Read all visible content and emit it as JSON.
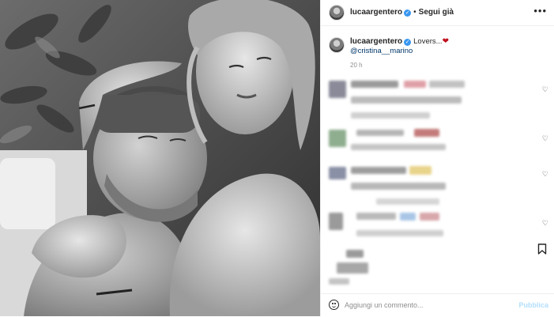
{
  "post": {
    "username": "lucaargentero",
    "follow_label": "Segui già",
    "more_icon": "•••",
    "caption": {
      "username": "lucaargentero",
      "message": "Lovers...",
      "heart": "❤",
      "mention": "@cristina__marino"
    },
    "time": "20 h",
    "photo_description": "Black and white photo of a couple embracing"
  },
  "comments": [
    {
      "blurred": true
    },
    {
      "blurred": true
    },
    {
      "blurred": true
    },
    {
      "blurred": true
    },
    {
      "blurred": true
    }
  ],
  "icons": {
    "like": "heart-outline-icon",
    "bookmark": "bookmark-icon",
    "emoji": "emoji-icon",
    "more": "more-options-icon",
    "verified": "verified-badge-icon"
  },
  "add_comment": {
    "placeholder": "Aggiungi un commento...",
    "publish_label": "Pubblica"
  },
  "colors": {
    "verified": "#3897f0",
    "mention": "#00376b",
    "publish": "#b2dffc",
    "heart": "#c0111f"
  }
}
